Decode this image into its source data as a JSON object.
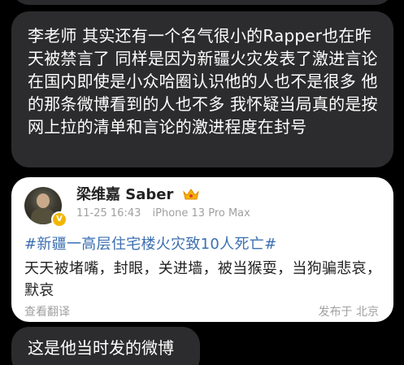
{
  "messages": {
    "main_text": "李老师 其实还有一个名气很小的Rapper也在昨天被禁言了 同样是因为新疆火灾发表了激进言论 在国内即使是小众哈圈认识他的人也不是很多 他的那条微博看到的人也不多 我怀疑当局真的是按网上拉的清单和言论的激进程度在封号",
    "bottom_text": "这是他当时发的微博"
  },
  "weibo_card": {
    "username": "梁维嘉 Saber",
    "badge_icon": "crown-icon",
    "timestamp": "11-25 16:43",
    "device": "iPhone 13 Pro Max",
    "topic": "#新疆一高层住宅楼火灾致10人死亡#",
    "body": "天天被堵嘴，封眼，关进墙，被当猴耍，当狗骗悲哀，默哀",
    "translate_label": "查看翻译",
    "location_label": "发布于 北京",
    "colors": {
      "topic": "#3b6fb0",
      "verify": "#f2b600"
    }
  }
}
